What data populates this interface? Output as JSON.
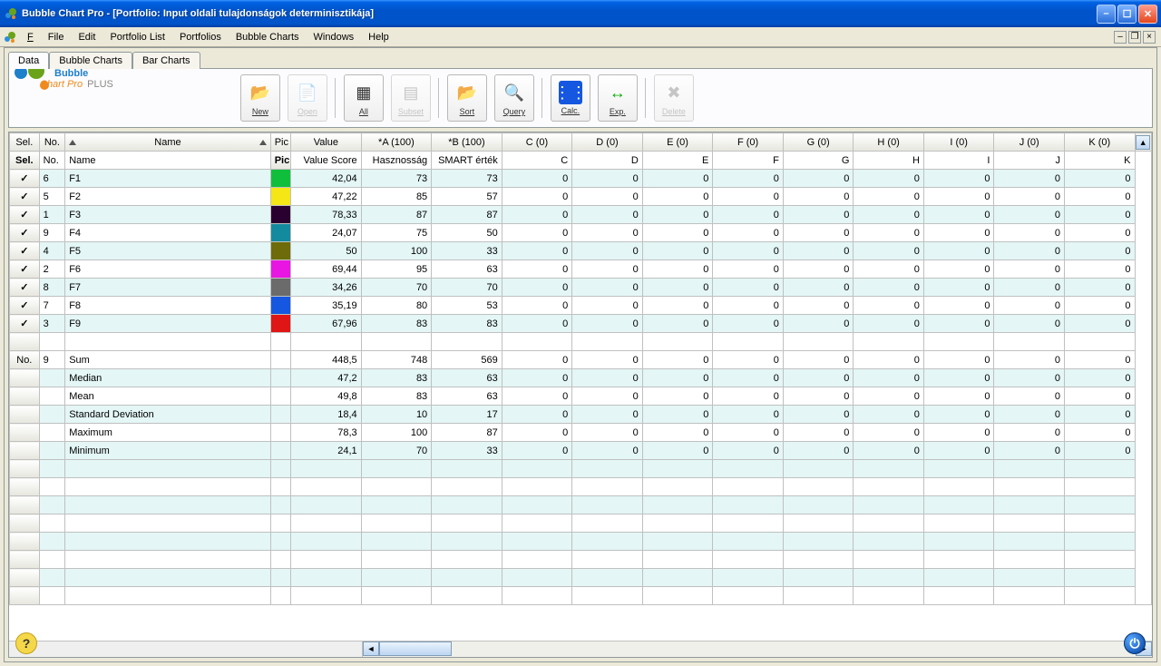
{
  "window": {
    "app_title": "Bubble Chart Pro",
    "doc_title": "[Portfolio: Input oldali tulajdonságok determinisztikája]"
  },
  "menu": {
    "file": "File",
    "edit": "Edit",
    "portfolio_list": "Portfolio List",
    "portfolios": "Portfolios",
    "bubble_charts": "Bubble Charts",
    "windows": "Windows",
    "help": "Help"
  },
  "tabs": {
    "data": "Data",
    "bubble": "Bubble Charts",
    "bar": "Bar Charts"
  },
  "logo": {
    "line1": "Bubble",
    "line2": "Chart Pro",
    "plus": "PLUS"
  },
  "toolbar": {
    "new": "New",
    "open": "Open",
    "all": "All",
    "subset": "Subset",
    "sort": "Sort",
    "query": "Query",
    "calc": "Calc.",
    "exp": "Exp.",
    "delete": "Delete"
  },
  "grid": {
    "h1": {
      "sel": "Sel.",
      "no": "No.",
      "name": "Name",
      "pic": "Pic",
      "value": "Value",
      "a": "*A (100)",
      "b": "*B (100)",
      "c": "C (0)",
      "d": "D (0)",
      "e": "E (0)",
      "f": "F (0)",
      "g": "G (0)",
      "h": "H (0)",
      "i": "I (0)",
      "j": "J (0)",
      "k": "K (0)"
    },
    "h2": {
      "sel": "Sel.",
      "no": "No.",
      "name": "Name",
      "pic": "Pic",
      "value": "Value Score",
      "a": "Hasznosság",
      "b": "SMART érték",
      "c": "C",
      "d": "D",
      "e": "E",
      "f": "F",
      "g": "G",
      "h": "H",
      "i": "I",
      "j": "J",
      "k": "K"
    },
    "rows": [
      {
        "no": "6",
        "name": "F1",
        "color": "#0fbf3c",
        "value": "42,04",
        "a": "73",
        "b": "73"
      },
      {
        "no": "5",
        "name": "F2",
        "color": "#f5e615",
        "value": "47,22",
        "a": "85",
        "b": "57"
      },
      {
        "no": "1",
        "name": "F3",
        "color": "#2a0030",
        "value": "78,33",
        "a": "87",
        "b": "87"
      },
      {
        "no": "9",
        "name": "F4",
        "color": "#138a9e",
        "value": "24,07",
        "a": "75",
        "b": "50"
      },
      {
        "no": "4",
        "name": "F5",
        "color": "#6d6b0a",
        "value": "50",
        "a": "100",
        "b": "33"
      },
      {
        "no": "2",
        "name": "F6",
        "color": "#e815e3",
        "value": "69,44",
        "a": "95",
        "b": "63"
      },
      {
        "no": "8",
        "name": "F7",
        "color": "#6b6b6b",
        "value": "34,26",
        "a": "70",
        "b": "70"
      },
      {
        "no": "7",
        "name": "F8",
        "color": "#1557e0",
        "value": "35,19",
        "a": "80",
        "b": "53"
      },
      {
        "no": "3",
        "name": "F9",
        "color": "#e01515",
        "value": "67,96",
        "a": "83",
        "b": "83"
      }
    ],
    "summary_header": {
      "sel": "No.",
      "no": "9"
    },
    "summary": [
      {
        "name": "Sum",
        "value": "448,5",
        "a": "748",
        "b": "569"
      },
      {
        "name": "Median",
        "value": "47,2",
        "a": "83",
        "b": "63"
      },
      {
        "name": "Mean",
        "value": "49,8",
        "a": "83",
        "b": "63"
      },
      {
        "name": "Standard Deviation",
        "value": "18,4",
        "a": "10",
        "b": "17"
      },
      {
        "name": "Maximum",
        "value": "78,3",
        "a": "100",
        "b": "87"
      },
      {
        "name": "Minimum",
        "value": "24,1",
        "a": "70",
        "b": "33"
      }
    ],
    "zero": "0"
  }
}
